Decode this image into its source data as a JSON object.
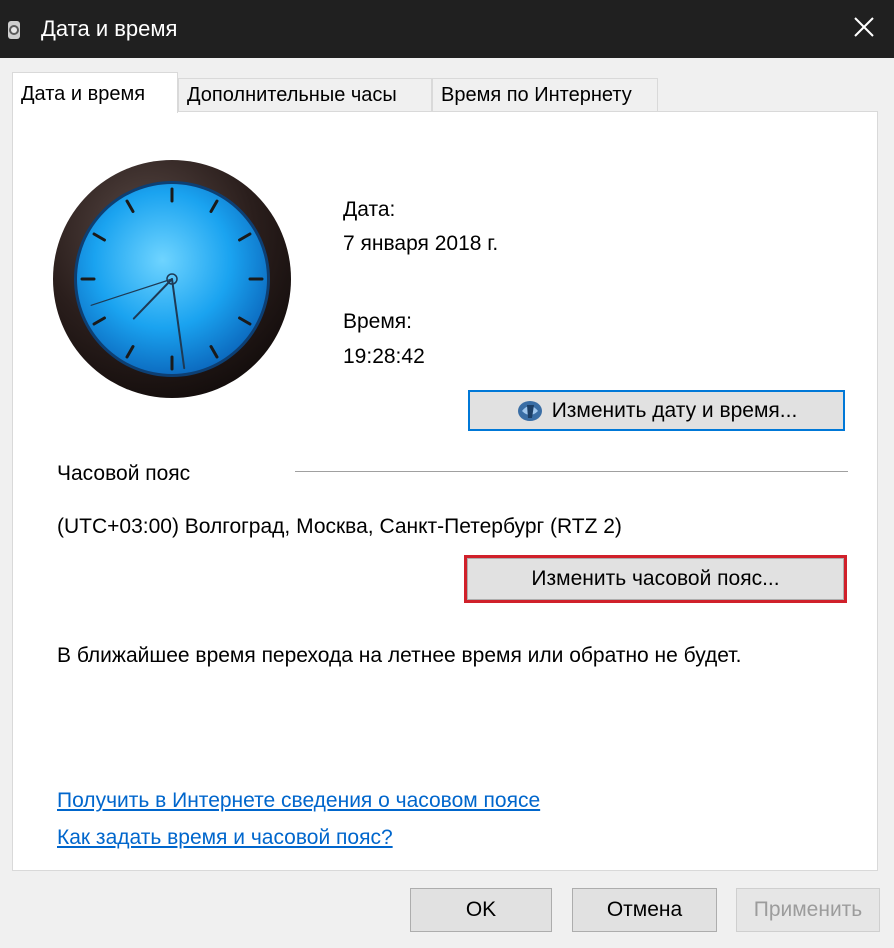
{
  "window": {
    "title": "Дата и время",
    "close_icon": "close-icon"
  },
  "tabs": [
    {
      "label": "Дата и время",
      "active": true
    },
    {
      "label": "Дополнительные часы",
      "active": false
    },
    {
      "label": "Время по Интернету",
      "active": false
    }
  ],
  "datetime": {
    "date_label": "Дата:",
    "date_value": "7 января 2018 г.",
    "time_label": "Время:",
    "time_value": "19:28:42",
    "change_button": "Изменить дату и время...",
    "change_button_icon": "shield-icon"
  },
  "clock": {
    "hours": 19,
    "minutes": 28,
    "seconds": 42,
    "face_color": "#1aa3f0",
    "rim_color": "#2a1e1c"
  },
  "timezone": {
    "section_label": "Часовой пояс",
    "value": "(UTC+03:00) Волгоград, Москва, Санкт-Петербург (RTZ 2)",
    "change_button": "Изменить часовой пояс..."
  },
  "dst_notice": "В ближайшее время перехода на летнее время или обратно не будет.",
  "links": {
    "online_info": "Получить в Интернете сведения о часовом поясе",
    "how_to": "Как задать время и часовой пояс?"
  },
  "footer": {
    "ok": "OK",
    "cancel": "Отмена",
    "apply": "Применить"
  },
  "colors": {
    "accent": "#0078d7",
    "highlight": "#d0202a",
    "link": "#0066cc"
  }
}
